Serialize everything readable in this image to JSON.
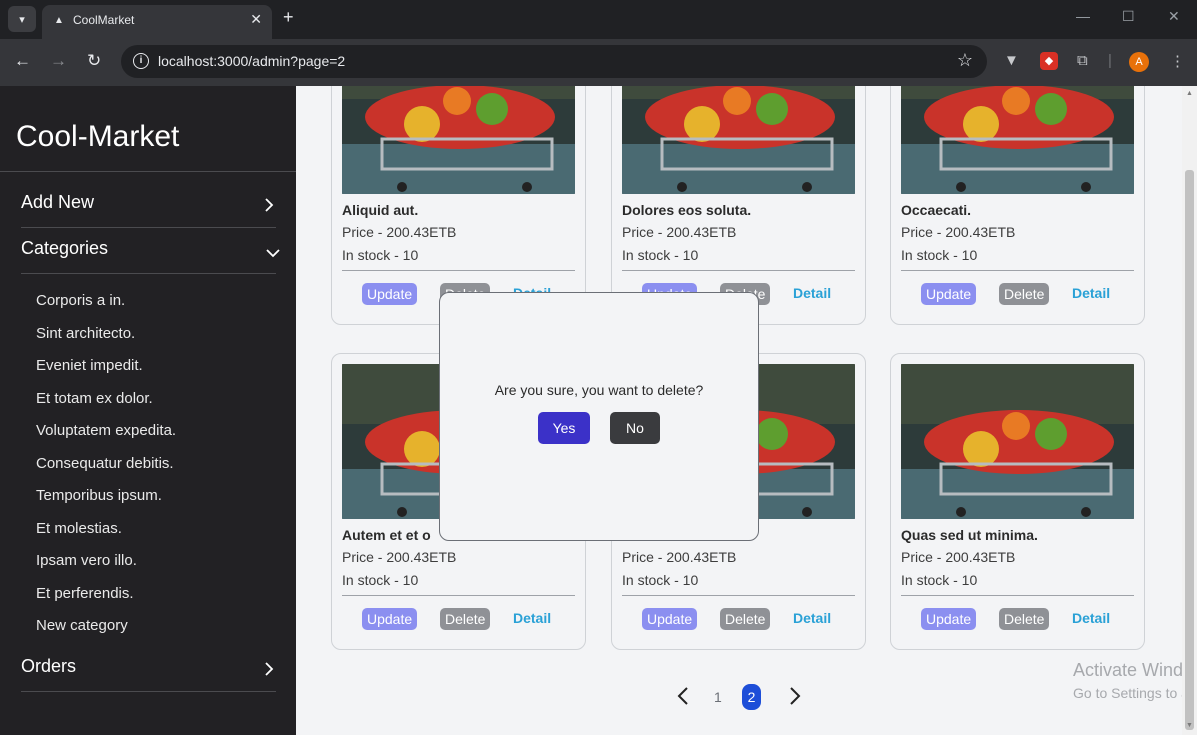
{
  "browser": {
    "tab_title": "CoolMarket",
    "url": "localhost:3000/admin?page=2",
    "profile_initial": "A"
  },
  "sidebar": {
    "brand": "Cool-Market",
    "add_new": "Add New",
    "categories_label": "Categories",
    "categories": [
      "Corporis a in.",
      "Sint architecto.",
      "Eveniet impedit.",
      "Et totam ex dolor.",
      "Voluptatem expedita.",
      "Consequatur debitis.",
      "Temporibus ipsum.",
      "Et molestias.",
      "Ipsam vero illo.",
      "Et perferendis.",
      "New category"
    ],
    "orders": "Orders"
  },
  "products": [
    {
      "title": "Aliquid aut.",
      "price": "Price - 200.43ETB",
      "stock": "In stock - 10"
    },
    {
      "title": "Dolores eos soluta.",
      "price": "Price - 200.43ETB",
      "stock": "In stock - 10"
    },
    {
      "title": "Occaecati.",
      "price": "Price - 200.43ETB",
      "stock": "In stock - 10"
    },
    {
      "title": "Autem et et o",
      "price": "Price - 200.43ETB",
      "stock": "In stock - 10"
    },
    {
      "title": "",
      "price": "Price - 200.43ETB",
      "stock": "In stock - 10"
    },
    {
      "title": "Quas sed ut minima.",
      "price": "Price - 200.43ETB",
      "stock": "In stock - 10"
    }
  ],
  "card_buttons": {
    "update": "Update",
    "delete": "Delete",
    "detail": "Detail"
  },
  "pagination": {
    "page1": "1",
    "page2": "2",
    "current": 2
  },
  "modal": {
    "message": "Are you sure, you want to delete?",
    "yes": "Yes",
    "no": "No"
  },
  "watermark": {
    "line1": "Activate Windows",
    "line2": "Go to Settings to activate Windows."
  },
  "colors": {
    "accent": "#1d4ed8",
    "update_btn": "#8b8ff0",
    "detail_link": "#2aa1d6",
    "sidebar_bg": "#222124"
  }
}
